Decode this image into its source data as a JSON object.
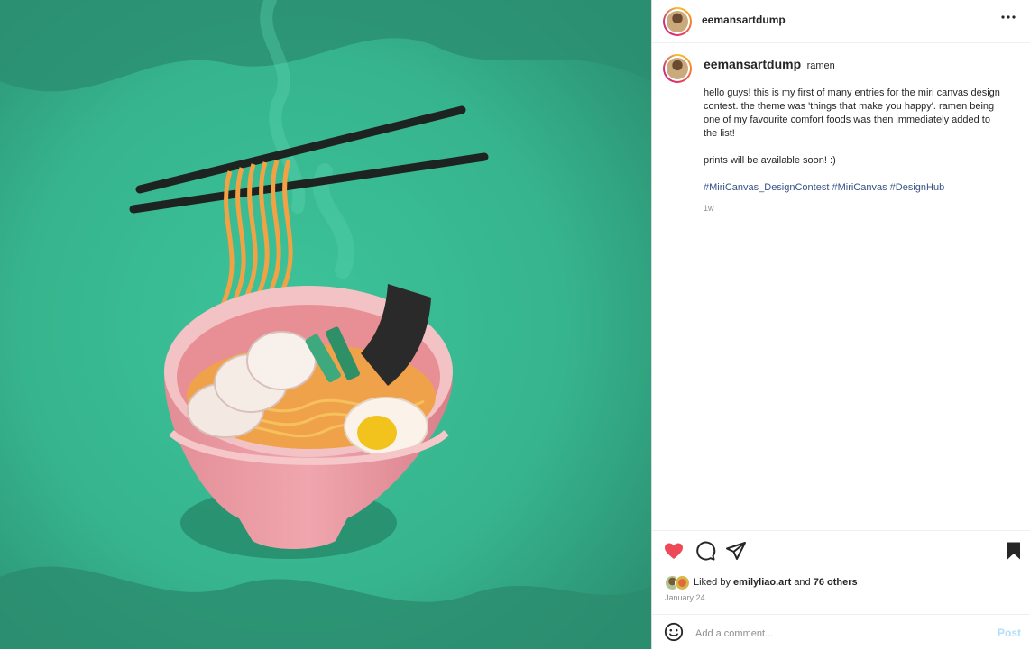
{
  "post": {
    "username": "eemansartdump",
    "more_icon": "more-horizontal-icon",
    "caption": {
      "author": "eemansartdump",
      "title": "ramen",
      "paragraph1": "hello guys! this is my first of many entries for the miri canvas design contest. the theme was 'things that make you happy'. ramen being one of my favourite comfort foods was then immediately added to the list!",
      "paragraph2": "prints will be available soon! :)",
      "hashtags": [
        "#MiriCanvas_DesignContest",
        "#MiriCanvas",
        "#DesignHub"
      ],
      "time": "1w"
    },
    "actions": {
      "like_icon": "heart-filled-icon",
      "comment_icon": "comment-icon",
      "share_icon": "share-icon",
      "save_icon": "bookmark-filled-icon",
      "liked": true,
      "like_color": "#ed4956"
    },
    "likes": {
      "prefix": "Liked by",
      "user": "emilyliao.art",
      "middle": "and",
      "others": "76 others"
    },
    "date": "January 24",
    "comment": {
      "emoji_icon": "emoji-icon",
      "placeholder": "Add a comment...",
      "post_label": "Post"
    }
  },
  "colors": {
    "background_green": "#2f9c78",
    "link_blue": "#385185",
    "post_disabled": "#b2dffc"
  }
}
